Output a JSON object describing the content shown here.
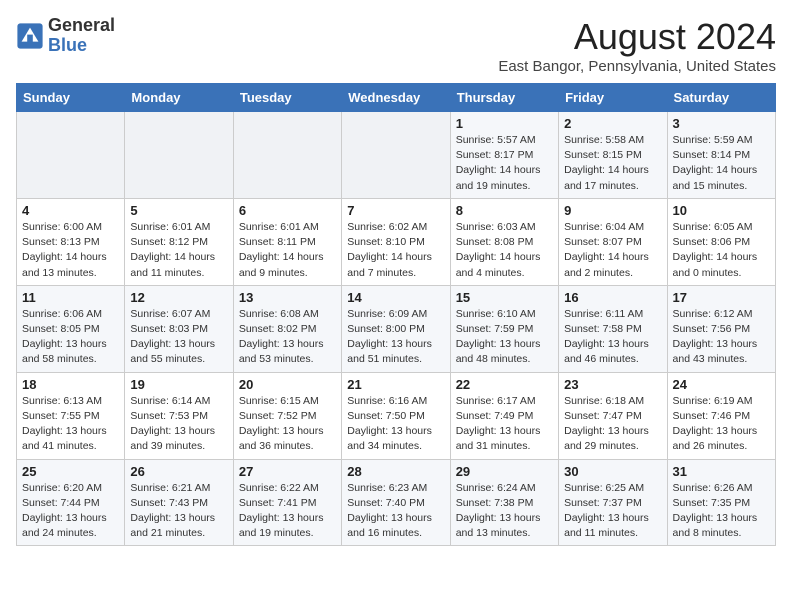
{
  "header": {
    "logo_line1": "General",
    "logo_line2": "Blue",
    "title": "August 2024",
    "subtitle": "East Bangor, Pennsylvania, United States"
  },
  "weekdays": [
    "Sunday",
    "Monday",
    "Tuesday",
    "Wednesday",
    "Thursday",
    "Friday",
    "Saturday"
  ],
  "weeks": [
    [
      {
        "day": "",
        "info": ""
      },
      {
        "day": "",
        "info": ""
      },
      {
        "day": "",
        "info": ""
      },
      {
        "day": "",
        "info": ""
      },
      {
        "day": "1",
        "info": "Sunrise: 5:57 AM\nSunset: 8:17 PM\nDaylight: 14 hours\nand 19 minutes."
      },
      {
        "day": "2",
        "info": "Sunrise: 5:58 AM\nSunset: 8:15 PM\nDaylight: 14 hours\nand 17 minutes."
      },
      {
        "day": "3",
        "info": "Sunrise: 5:59 AM\nSunset: 8:14 PM\nDaylight: 14 hours\nand 15 minutes."
      }
    ],
    [
      {
        "day": "4",
        "info": "Sunrise: 6:00 AM\nSunset: 8:13 PM\nDaylight: 14 hours\nand 13 minutes."
      },
      {
        "day": "5",
        "info": "Sunrise: 6:01 AM\nSunset: 8:12 PM\nDaylight: 14 hours\nand 11 minutes."
      },
      {
        "day": "6",
        "info": "Sunrise: 6:01 AM\nSunset: 8:11 PM\nDaylight: 14 hours\nand 9 minutes."
      },
      {
        "day": "7",
        "info": "Sunrise: 6:02 AM\nSunset: 8:10 PM\nDaylight: 14 hours\nand 7 minutes."
      },
      {
        "day": "8",
        "info": "Sunrise: 6:03 AM\nSunset: 8:08 PM\nDaylight: 14 hours\nand 4 minutes."
      },
      {
        "day": "9",
        "info": "Sunrise: 6:04 AM\nSunset: 8:07 PM\nDaylight: 14 hours\nand 2 minutes."
      },
      {
        "day": "10",
        "info": "Sunrise: 6:05 AM\nSunset: 8:06 PM\nDaylight: 14 hours\nand 0 minutes."
      }
    ],
    [
      {
        "day": "11",
        "info": "Sunrise: 6:06 AM\nSunset: 8:05 PM\nDaylight: 13 hours\nand 58 minutes."
      },
      {
        "day": "12",
        "info": "Sunrise: 6:07 AM\nSunset: 8:03 PM\nDaylight: 13 hours\nand 55 minutes."
      },
      {
        "day": "13",
        "info": "Sunrise: 6:08 AM\nSunset: 8:02 PM\nDaylight: 13 hours\nand 53 minutes."
      },
      {
        "day": "14",
        "info": "Sunrise: 6:09 AM\nSunset: 8:00 PM\nDaylight: 13 hours\nand 51 minutes."
      },
      {
        "day": "15",
        "info": "Sunrise: 6:10 AM\nSunset: 7:59 PM\nDaylight: 13 hours\nand 48 minutes."
      },
      {
        "day": "16",
        "info": "Sunrise: 6:11 AM\nSunset: 7:58 PM\nDaylight: 13 hours\nand 46 minutes."
      },
      {
        "day": "17",
        "info": "Sunrise: 6:12 AM\nSunset: 7:56 PM\nDaylight: 13 hours\nand 43 minutes."
      }
    ],
    [
      {
        "day": "18",
        "info": "Sunrise: 6:13 AM\nSunset: 7:55 PM\nDaylight: 13 hours\nand 41 minutes."
      },
      {
        "day": "19",
        "info": "Sunrise: 6:14 AM\nSunset: 7:53 PM\nDaylight: 13 hours\nand 39 minutes."
      },
      {
        "day": "20",
        "info": "Sunrise: 6:15 AM\nSunset: 7:52 PM\nDaylight: 13 hours\nand 36 minutes."
      },
      {
        "day": "21",
        "info": "Sunrise: 6:16 AM\nSunset: 7:50 PM\nDaylight: 13 hours\nand 34 minutes."
      },
      {
        "day": "22",
        "info": "Sunrise: 6:17 AM\nSunset: 7:49 PM\nDaylight: 13 hours\nand 31 minutes."
      },
      {
        "day": "23",
        "info": "Sunrise: 6:18 AM\nSunset: 7:47 PM\nDaylight: 13 hours\nand 29 minutes."
      },
      {
        "day": "24",
        "info": "Sunrise: 6:19 AM\nSunset: 7:46 PM\nDaylight: 13 hours\nand 26 minutes."
      }
    ],
    [
      {
        "day": "25",
        "info": "Sunrise: 6:20 AM\nSunset: 7:44 PM\nDaylight: 13 hours\nand 24 minutes."
      },
      {
        "day": "26",
        "info": "Sunrise: 6:21 AM\nSunset: 7:43 PM\nDaylight: 13 hours\nand 21 minutes."
      },
      {
        "day": "27",
        "info": "Sunrise: 6:22 AM\nSunset: 7:41 PM\nDaylight: 13 hours\nand 19 minutes."
      },
      {
        "day": "28",
        "info": "Sunrise: 6:23 AM\nSunset: 7:40 PM\nDaylight: 13 hours\nand 16 minutes."
      },
      {
        "day": "29",
        "info": "Sunrise: 6:24 AM\nSunset: 7:38 PM\nDaylight: 13 hours\nand 13 minutes."
      },
      {
        "day": "30",
        "info": "Sunrise: 6:25 AM\nSunset: 7:37 PM\nDaylight: 13 hours\nand 11 minutes."
      },
      {
        "day": "31",
        "info": "Sunrise: 6:26 AM\nSunset: 7:35 PM\nDaylight: 13 hours\nand 8 minutes."
      }
    ]
  ]
}
